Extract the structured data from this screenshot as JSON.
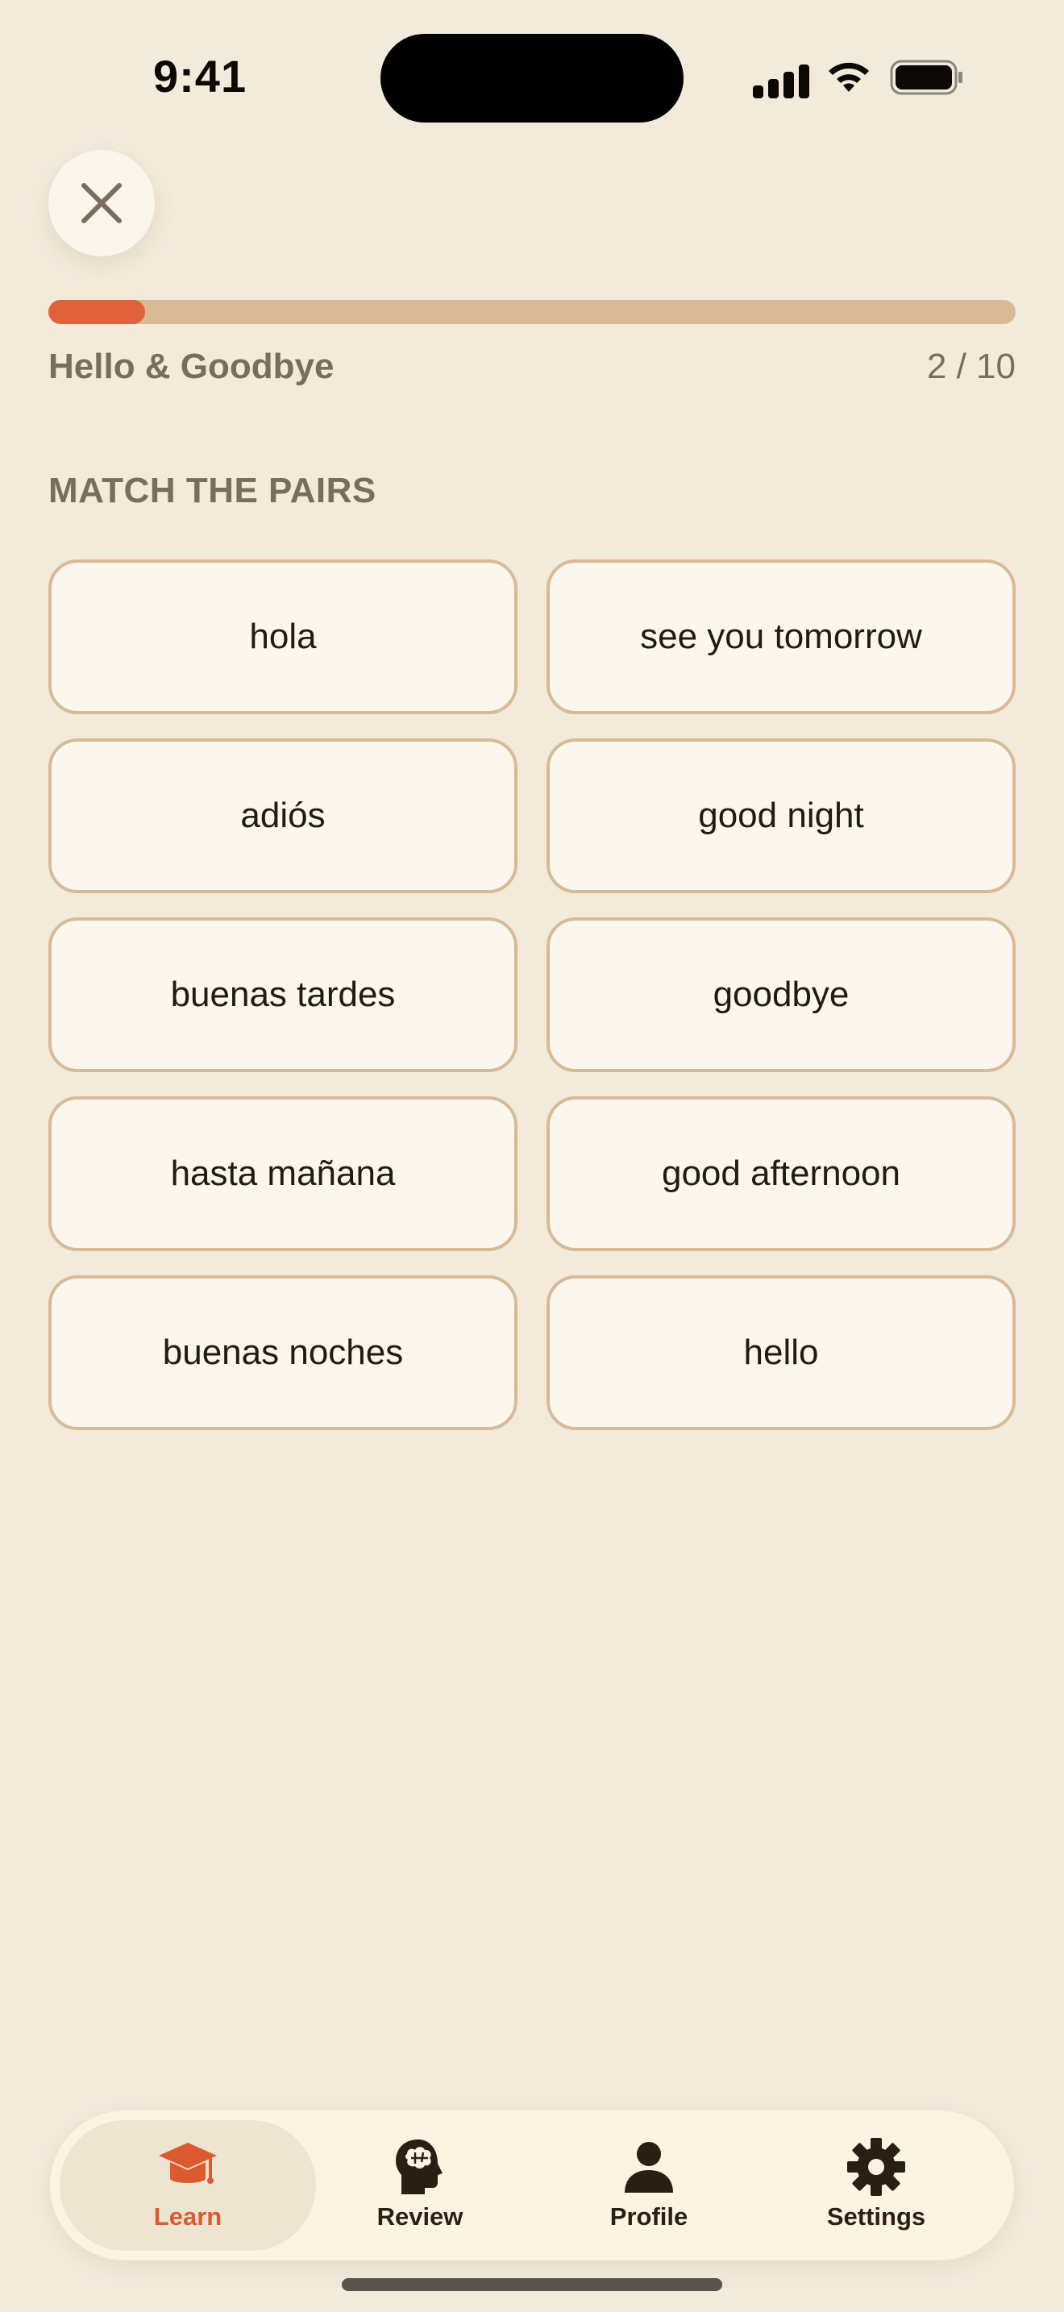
{
  "status_bar": {
    "time": "9:41"
  },
  "lesson": {
    "title": "Hello & Goodbye",
    "count": "2 / 10",
    "progress_percent": 10
  },
  "instruction": "MATCH THE PAIRS",
  "pairs": [
    {
      "left": "hola",
      "right": "see you tomorrow"
    },
    {
      "left": "adiós",
      "right": "good night"
    },
    {
      "left": "buenas tardes",
      "right": "goodbye"
    },
    {
      "left": "hasta mañana",
      "right": "good afternoon"
    },
    {
      "left": "buenas noches",
      "right": "hello"
    }
  ],
  "tabs": [
    {
      "label": "Learn",
      "icon": "graduation-cap-icon",
      "active": true
    },
    {
      "label": "Review",
      "icon": "brain-head-icon",
      "active": false
    },
    {
      "label": "Profile",
      "icon": "person-icon",
      "active": false
    },
    {
      "label": "Settings",
      "icon": "gear-icon",
      "active": false
    }
  ],
  "colors": {
    "accent": "#E2603A",
    "background": "#F2EADB",
    "card_border": "#D8BA97",
    "muted_text": "#7A6C5E"
  }
}
